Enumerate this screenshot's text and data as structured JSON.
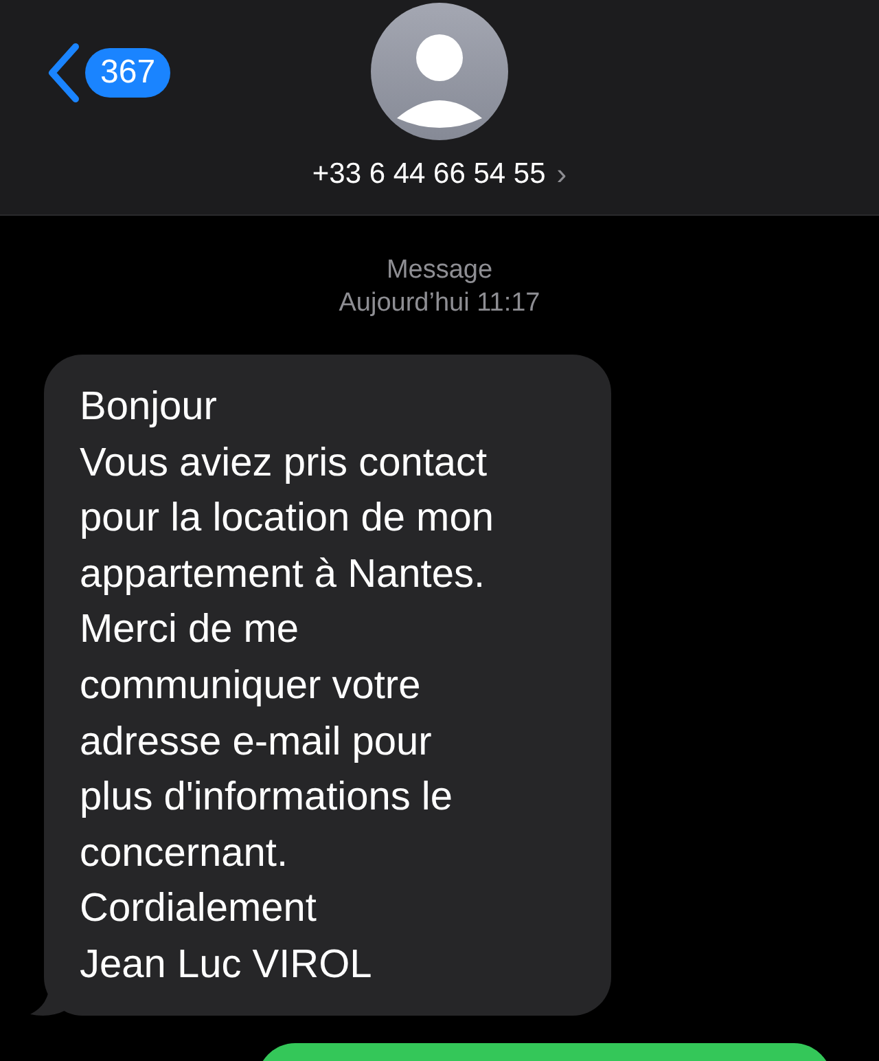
{
  "header": {
    "back_count": "367",
    "contact": "+33 6 44 66 54 55",
    "chevron": "›"
  },
  "conversation": {
    "label": "Message",
    "timestamp": "Aujourd’hui 11:17"
  },
  "messages": [
    {
      "kind": "incoming",
      "text": "Bonjour\nVous aviez pris contact\npour la location de mon\nappartement à Nantes.\nMerci de me\ncommuniquer votre\nadresse e-mail pour\nplus d'informations le\nconcernant.\nCordialement\nJean Luc VIROL"
    },
    {
      "kind": "outgoing"
    }
  ]
}
